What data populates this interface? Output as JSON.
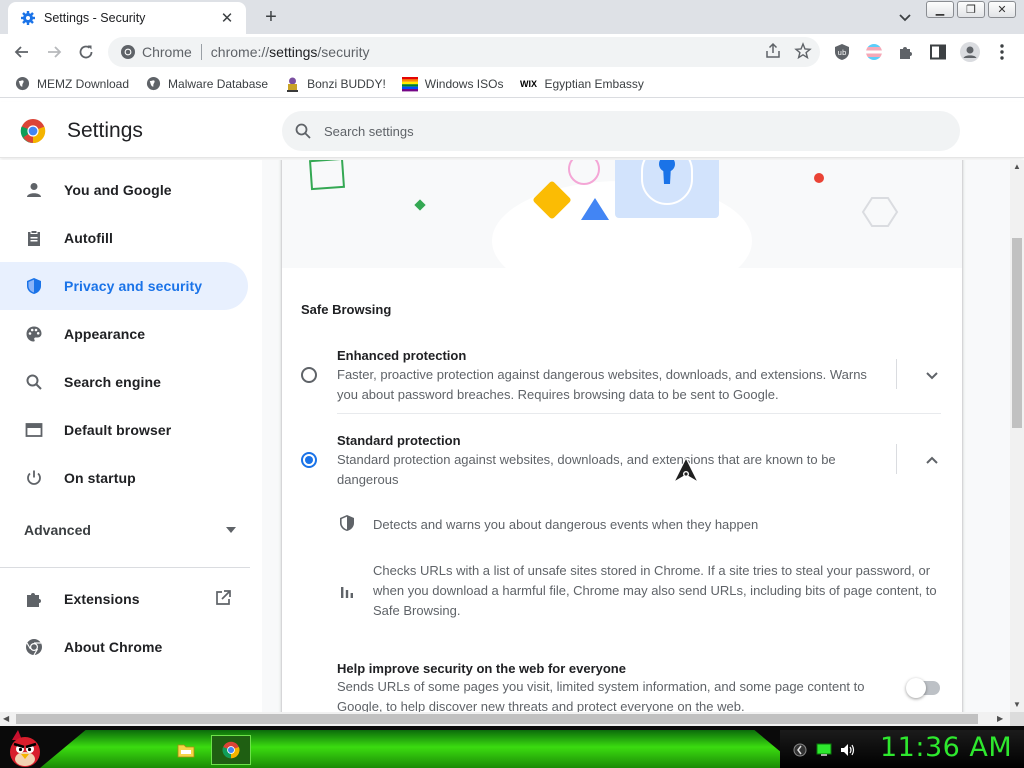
{
  "browser": {
    "tab": {
      "title": "Settings - Security",
      "favicon": "gear-icon"
    },
    "window_controls": [
      "minimize-icon",
      "restore-icon",
      "close-icon"
    ],
    "omnibox": {
      "site_label": "Chrome",
      "url_prefix": "chrome://",
      "url_host": "settings",
      "url_path": "/security"
    },
    "bookmarks": [
      {
        "label": "MEMZ Download",
        "icon": "globe-icon"
      },
      {
        "label": "Malware Database",
        "icon": "globe-icon"
      },
      {
        "label": "Bonzi BUDDY!",
        "icon": "bonzi-icon"
      },
      {
        "label": "Windows ISOs",
        "icon": "windows-flag-icon"
      },
      {
        "label": "Egyptian Embassy",
        "icon": "wix-icon"
      }
    ],
    "wix_text": "WIX"
  },
  "settings": {
    "title": "Settings",
    "search_placeholder": "Search settings",
    "nav": [
      {
        "label": "You and Google",
        "icon": "person-icon"
      },
      {
        "label": "Autofill",
        "icon": "clipboard-icon"
      },
      {
        "label": "Privacy and security",
        "icon": "shield-icon",
        "active": true
      },
      {
        "label": "Appearance",
        "icon": "palette-icon"
      },
      {
        "label": "Search engine",
        "icon": "search-icon"
      },
      {
        "label": "Default browser",
        "icon": "browser-window-icon"
      },
      {
        "label": "On startup",
        "icon": "power-icon"
      }
    ],
    "advanced_label": "Advanced",
    "nav_bottom": [
      {
        "label": "Extensions",
        "icon": "puzzle-icon"
      },
      {
        "label": "About Chrome",
        "icon": "chrome-logo-icon"
      }
    ]
  },
  "main": {
    "section_title": "Safe Browsing",
    "options": [
      {
        "title": "Enhanced protection",
        "desc": "Faster, proactive protection against dangerous websites, downloads, and extensions. Warns you about password breaches. Requires browsing data to be sent to Google.",
        "selected": false,
        "expanded": false
      },
      {
        "title": "Standard protection",
        "desc": "Standard protection against websites, downloads, and extensions that are known to be dangerous",
        "selected": true,
        "expanded": true
      }
    ],
    "details": [
      {
        "icon": "shield-icon",
        "text": "Detects and warns you about dangerous events when they happen"
      },
      {
        "icon": "bar-chart-icon",
        "text": "Checks URLs with a list of unsafe sites stored in Chrome. If a site tries to steal your password, or when you download a harmful file, Chrome may also send URLs, including bits of page content, to Safe Browsing."
      }
    ],
    "help": {
      "title": "Help improve security on the web for everyone",
      "desc": "Sends URLs of some pages you visit, limited system information, and some page content to Google, to help discover new threats and protect everyone on the web.",
      "toggle_on": false
    }
  },
  "taskbar": {
    "clock": "11:36 AM",
    "apps": [
      "folder-icon",
      "chrome-logo-icon"
    ],
    "tray": [
      "network-icon",
      "monitor-icon",
      "volume-icon"
    ]
  },
  "colors": {
    "accent": "#1a73e8",
    "active_bg": "#e8f0fe",
    "clock": "#2ee82e"
  }
}
